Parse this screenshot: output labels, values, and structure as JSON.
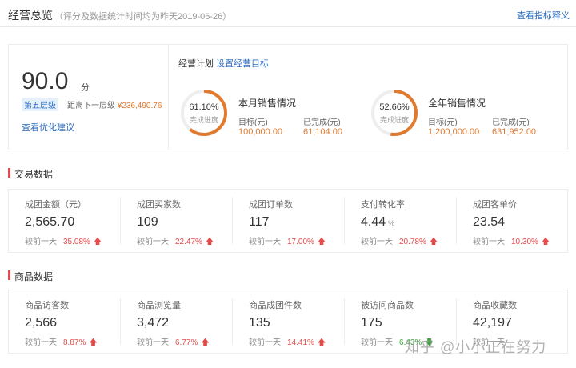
{
  "header": {
    "title": "经营总览",
    "subtitle": "（评分及数据统计时间均为昨天2019-06-26）",
    "metric_link": "查看指标释义"
  },
  "overview": {
    "score": "90.0",
    "score_unit": "分",
    "level": "第五层级",
    "next_level_label": "距离下一层级",
    "next_level_amount": "¥236,490.76",
    "optimize_link": "查看优化建议",
    "plan_label": "经营计划",
    "plan_link": "设置经营目标",
    "monthly": {
      "title": "本月销售情况",
      "percent": "61.10%",
      "progress": 0.611,
      "progress_label": "完成进度",
      "target_label": "目标(元)",
      "target": "100,000.00",
      "done_label": "已完成(元)",
      "done": "61,104.00"
    },
    "yearly": {
      "title": "全年销售情况",
      "percent": "52.66%",
      "progress": 0.5266,
      "progress_label": "完成进度",
      "target_label": "目标(元)",
      "target": "1,200,000.00",
      "done_label": "已完成(元)",
      "done": "631,952.00"
    }
  },
  "colors": {
    "accent_orange": "#e27a2e",
    "link_blue": "#2a6bbf",
    "up_red": "#e34b4b",
    "down_green": "#3aa23a"
  },
  "trade": {
    "section_title": "交易数据",
    "metrics": [
      {
        "label": "成团金额（元）",
        "value": "2,565.70",
        "unit": "",
        "compare": "较前一天",
        "change": "35.08%",
        "direction": "up"
      },
      {
        "label": "成团买家数",
        "value": "109",
        "unit": "",
        "compare": "较前一天",
        "change": "22.47%",
        "direction": "up"
      },
      {
        "label": "成团订单数",
        "value": "117",
        "unit": "",
        "compare": "较前一天",
        "change": "17.00%",
        "direction": "up"
      },
      {
        "label": "支付转化率",
        "value": "4.44",
        "unit": "%",
        "compare": "较前一天",
        "change": "20.78%",
        "direction": "up"
      },
      {
        "label": "成团客单价",
        "value": "23.54",
        "unit": "",
        "compare": "较前一天",
        "change": "10.30%",
        "direction": "up"
      }
    ]
  },
  "goods": {
    "section_title": "商品数据",
    "metrics": [
      {
        "label": "商品访客数",
        "value": "2,566",
        "unit": "",
        "compare": "较前一天",
        "change": "8.87%",
        "direction": "up"
      },
      {
        "label": "商品浏览量",
        "value": "3,472",
        "unit": "",
        "compare": "较前一天",
        "change": "6.77%",
        "direction": "up"
      },
      {
        "label": "商品成团件数",
        "value": "135",
        "unit": "",
        "compare": "较前一天",
        "change": "14.41%",
        "direction": "up"
      },
      {
        "label": "被访问商品数",
        "value": "175",
        "unit": "",
        "compare": "较前一天",
        "change": "6.43%",
        "direction": "down"
      },
      {
        "label": "商品收藏数",
        "value": "42,197",
        "unit": "",
        "compare": "较前一天",
        "change": "",
        "direction": "up"
      }
    ]
  },
  "watermark": "知乎 @小小正在努力"
}
